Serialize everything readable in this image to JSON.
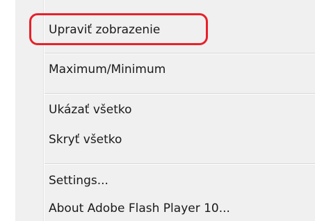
{
  "context_menu": {
    "items": [
      {
        "label": "Upraviť zobrazenie"
      },
      {
        "label": "Maximum/Minimum"
      },
      {
        "label": "Ukázať všetko"
      },
      {
        "label": "Skryť všetko"
      },
      {
        "label": "Settings..."
      },
      {
        "label": "About Adobe Flash Player 10..."
      }
    ]
  },
  "annotation": {
    "highlight_color": "#e8202a",
    "highlighted_item": "Upraviť zobrazenie"
  },
  "colors": {
    "menu_background": "#f0f0f0",
    "separator": "#d7d7d7",
    "text": "#1a1a1a"
  }
}
